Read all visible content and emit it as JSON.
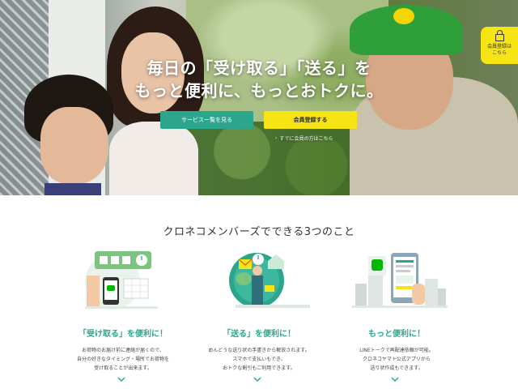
{
  "hero": {
    "title_line1": "毎日の「受け取る」「送る」を",
    "title_line2": "もっと便利に、もっとおトクに。",
    "services_button": "サービス一覧を見る",
    "register_button": "会員登録する",
    "login_link": "すでに会員の方はこちら",
    "member_badge_line1": "会員登録は",
    "member_badge_line2": "こちら"
  },
  "section": {
    "title": "クロネコメンバーズでできる3つのこと"
  },
  "features": [
    {
      "title": "「受け取る」を便利に！",
      "desc": [
        "お荷物のお届け前に連絡が届くので、",
        "自分の好きなタイミング・場所でお荷物を",
        "受け取ることが出来ます。"
      ],
      "icon": "receive-illustration-icon"
    },
    {
      "title": "「送る」を便利に！",
      "desc": [
        "めんどうな送り状の手書きから解放されます。",
        "スマホで支払いもでき、",
        "おトクな割引もご利用できます。"
      ],
      "icon": "send-illustration-icon"
    },
    {
      "title": "もっと便利に！",
      "desc": [
        "LINEトークで再配達依頼が可能。",
        "クロネコヤマト公式アプリから",
        "送り状作成もできます。"
      ],
      "icon": "app-illustration-icon"
    }
  ],
  "illustrations": {
    "line_label": "LINE",
    "chat_label": "LINE"
  },
  "colors": {
    "accent_green": "#2ca58d",
    "accent_yellow": "#f7e414"
  }
}
